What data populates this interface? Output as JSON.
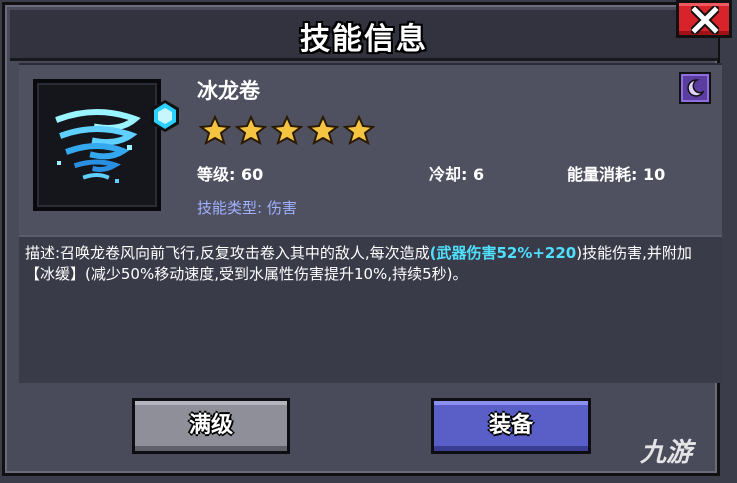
{
  "dialog": {
    "title": "技能信息"
  },
  "skill": {
    "name": "冰龙卷",
    "stars": 5,
    "level_label": "等级: 60",
    "cooldown_label": "冷却: 6",
    "energy_label": "能量消耗: 10",
    "type_label": "技能类型: 伤害"
  },
  "description": {
    "part1": "描述:召唤龙卷风向前飞行,反复攻击卷入其中的敌人,每次造成",
    "highlight": "(武器伤害52%+220",
    "part2": ")技能伤害,并附加【冰缓】(减少50%移动速度,受到水属性伤害提升10%,持续5秒)。"
  },
  "buttons": {
    "max_label": "满级",
    "equip_label": "装备"
  },
  "icons": {
    "close": "close-icon",
    "tornado": "tornado-icon",
    "gem": "gem-icon",
    "moon": "moon-icon",
    "star": "star-icon"
  },
  "colors": {
    "highlight": "#4fe0ff",
    "close_button": "#d8232a",
    "equip_button": "#5a5fc8",
    "max_button": "#8e8f99",
    "star": "#f5c542"
  },
  "watermark": "九游"
}
